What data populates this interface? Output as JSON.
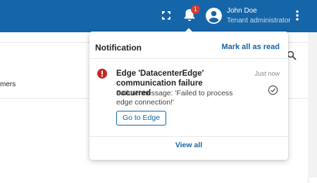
{
  "topbar": {
    "background": "#1565a9",
    "fullscreen_icon": "fullscreen-icon",
    "bell_icon": "bell-icon",
    "notification_count": "1",
    "avatar_icon": "account-circle-icon",
    "user_name": "John Doe",
    "user_role": "Tenant administrator",
    "more_icon": "more-vert-icon"
  },
  "background_page": {
    "partial_label": "mers",
    "search_icon": "search-icon"
  },
  "notification_panel": {
    "title": "Notification",
    "mark_all_label": "Mark all as read",
    "items": [
      {
        "status_icon": "error-icon",
        "status_color": "#c62828",
        "title": "Edge 'DatacenterEdge' communication failure occurred",
        "time": "Just now",
        "message": "Failure message: 'Failed to process edge connection!'",
        "action_label": "Go to Edge",
        "read_icon": "check-circle-icon"
      }
    ],
    "view_all_label": "View all",
    "accent": "#1565a9"
  }
}
